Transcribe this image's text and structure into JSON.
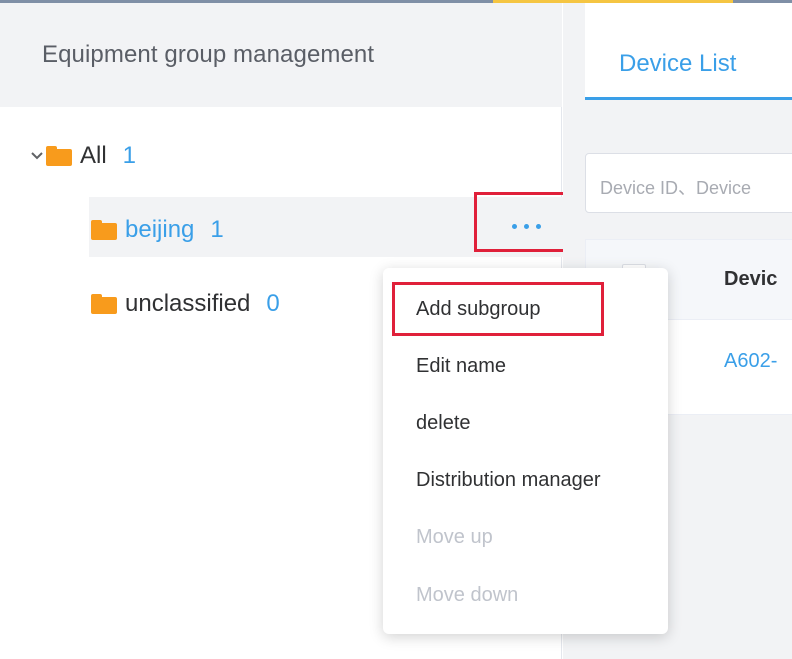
{
  "sidebar": {
    "title": "Equipment group management",
    "tree": [
      {
        "label": "All",
        "count": "1"
      },
      {
        "label": "beijing",
        "count": "1"
      },
      {
        "label": "unclassified",
        "count": "0"
      }
    ]
  },
  "context_menu": {
    "items": [
      {
        "label": "Add subgroup",
        "enabled": true
      },
      {
        "label": "Edit name",
        "enabled": true
      },
      {
        "label": "delete",
        "enabled": true
      },
      {
        "label": "Distribution manager",
        "enabled": true
      },
      {
        "label": "Move up",
        "enabled": false
      },
      {
        "label": "Move down",
        "enabled": false
      }
    ]
  },
  "main": {
    "tab_label": "Device List",
    "search_placeholder": "Device ID、Device",
    "table": {
      "column_header": "Devic",
      "rows": [
        "A602-"
      ]
    }
  },
  "colors": {
    "accent": "#3a9fe8",
    "folder": "#f89b1c",
    "highlight": "#e0203a"
  },
  "icons": [
    "chevron-down-icon",
    "folder-icon",
    "more-icon"
  ]
}
